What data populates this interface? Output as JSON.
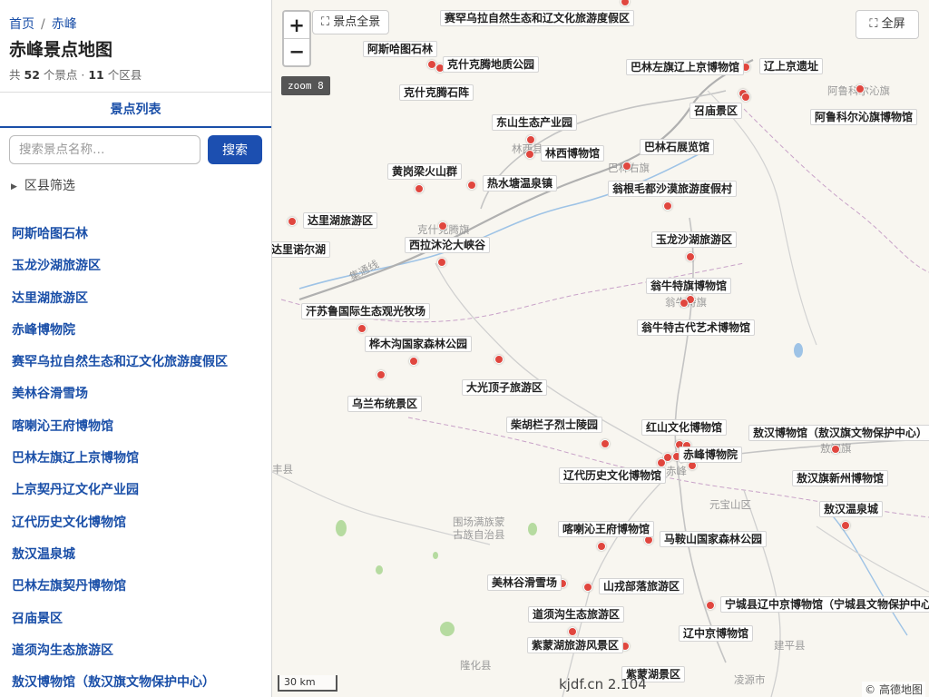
{
  "breadcrumb": {
    "home": "首页",
    "current": "赤峰"
  },
  "page_title": "赤峰景点地图",
  "summary": {
    "prefix": "共",
    "spots": "52",
    "mid": "个景点 ·",
    "districts": "11",
    "suffix": "个区县"
  },
  "tab_label": "景点列表",
  "search": {
    "placeholder": "搜索景点名称…",
    "button": "搜索"
  },
  "district_filter": "区县筛选",
  "spot_list": [
    "阿斯哈图石林",
    "玉龙沙湖旅游区",
    "达里湖旅游区",
    "赤峰博物院",
    "赛罕乌拉自然生态和辽文化旅游度假区",
    "美林谷滑雪场",
    "喀喇沁王府博物馆",
    "巴林左旗辽上京博物馆",
    "上京契丹辽文化产业园",
    "辽代历史文化博物馆",
    "敖汉温泉城",
    "巴林左旗契丹博物馆",
    "召庙景区",
    "道须沟生态旅游区",
    "敖汉博物馆（敖汉旗文物保护中心）"
  ],
  "map": {
    "zoom_in": "+",
    "zoom_out": "−",
    "overview_label": "⛶ 景点全景",
    "zoom_badge": "zoom 8",
    "fullscreen_label": "⛶ 全屏",
    "scale": "30 km",
    "watermark": "kjdf.cn 2.104",
    "attribution": "© 高德地图",
    "icons": {
      "overview": "expand-icon",
      "fullscreen": "expand-icon"
    },
    "colors": {
      "marker": "#e0463e",
      "road": "#b0b0b0",
      "river": "#9ec3e6",
      "green": "#b6dba0"
    },
    "places": [
      {
        "name": "阿鲁科尔沁旗"
      },
      {
        "name": "巴林右旗"
      },
      {
        "name": "林西县"
      },
      {
        "name": "克什克腾旗"
      },
      {
        "name": "翁牛特旗"
      },
      {
        "name": "敖汉旗"
      },
      {
        "name": "元宝山区"
      },
      {
        "name": "围场满族蒙"
      },
      {
        "name": "古族自治县"
      },
      {
        "name": "隆化县"
      },
      {
        "name": "建平县"
      },
      {
        "name": "凌源市"
      },
      {
        "name": "集通线"
      },
      {
        "name": "赤峰"
      },
      {
        "name": "丰县"
      }
    ],
    "pois": [
      {
        "name": "赛罕乌拉自然生态和辽文化旅游度假区"
      },
      {
        "name": "阿斯哈图石林"
      },
      {
        "name": "克什克腾地质公园"
      },
      {
        "name": "巴林左旗辽上京博物馆"
      },
      {
        "name": "辽上京遗址"
      },
      {
        "name": "克什克腾石阵"
      },
      {
        "name": "召庙景区"
      },
      {
        "name": "阿鲁科尔沁旗博物馆"
      },
      {
        "name": "东山生态产业园"
      },
      {
        "name": "巴林石展览馆"
      },
      {
        "name": "林西博物馆"
      },
      {
        "name": "黄岗梁火山群"
      },
      {
        "name": "热水塘温泉镇"
      },
      {
        "name": "翁根毛都沙漠旅游度假村"
      },
      {
        "name": "达里湖旅游区"
      },
      {
        "name": "达里诺尔湖"
      },
      {
        "name": "西拉沐沦大峡谷"
      },
      {
        "name": "玉龙沙湖旅游区"
      },
      {
        "name": "翁牛特旗博物馆"
      },
      {
        "name": "汗苏鲁国际生态观光牧场"
      },
      {
        "name": "翁牛特古代艺术博物馆"
      },
      {
        "name": "桦木沟国家森林公园"
      },
      {
        "name": "大光顶子旅游区"
      },
      {
        "name": "乌兰布统景区"
      },
      {
        "name": "柴胡栏子烈士陵园"
      },
      {
        "name": "红山文化博物馆"
      },
      {
        "name": "敖汉博物馆（敖汉旗文物保护中心）"
      },
      {
        "name": "赤峰博物院"
      },
      {
        "name": "辽代历史文化博物馆"
      },
      {
        "name": "敖汉旗新州博物馆"
      },
      {
        "name": "敖汉温泉城"
      },
      {
        "name": "喀喇沁王府博物馆"
      },
      {
        "name": "马鞍山国家森林公园"
      },
      {
        "name": "美林谷滑雪场"
      },
      {
        "name": "山戎部落旅游区"
      },
      {
        "name": "宁城县辽中京博物馆（宁城县文物保护中心）"
      },
      {
        "name": "道须沟生态旅游区"
      },
      {
        "name": "辽中京博物馆"
      },
      {
        "name": "紫蒙湖旅游风景区"
      },
      {
        "name": "紫蒙湖景区"
      }
    ]
  }
}
